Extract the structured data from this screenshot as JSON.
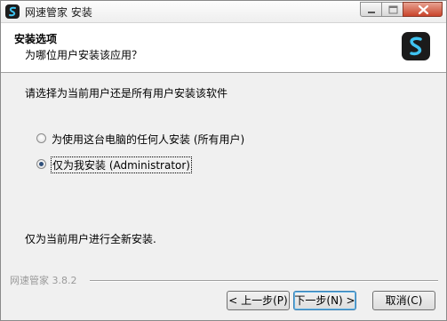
{
  "window": {
    "title": "网速管家 安装",
    "icons": {
      "app": "app-logo-icon",
      "minimize": "minimize-icon",
      "maximize": "maximize-icon",
      "close": "close-icon"
    }
  },
  "header": {
    "title": "安装选项",
    "subtitle": "为哪位用户安装该应用？"
  },
  "content": {
    "instruction": "请选择为当前用户还是所有用户安装该软件",
    "options": [
      {
        "label": "为使用这台电脑的任何人安装 (所有用户)",
        "checked": false
      },
      {
        "label": "仅为我安装 (Administrator)",
        "checked": true
      }
    ],
    "description": "仅为当前用户进行全新安装."
  },
  "footer": {
    "brand": "网速管家 3.8.2",
    "back_label": "< 上一步(P)",
    "next_label": "下一步(N) >",
    "cancel_label": "取消(C)"
  },
  "colors": {
    "logo_background": "#1b1b1b",
    "logo_accent": "#3fc3f0",
    "default_button_border": "#3c7fb1"
  }
}
